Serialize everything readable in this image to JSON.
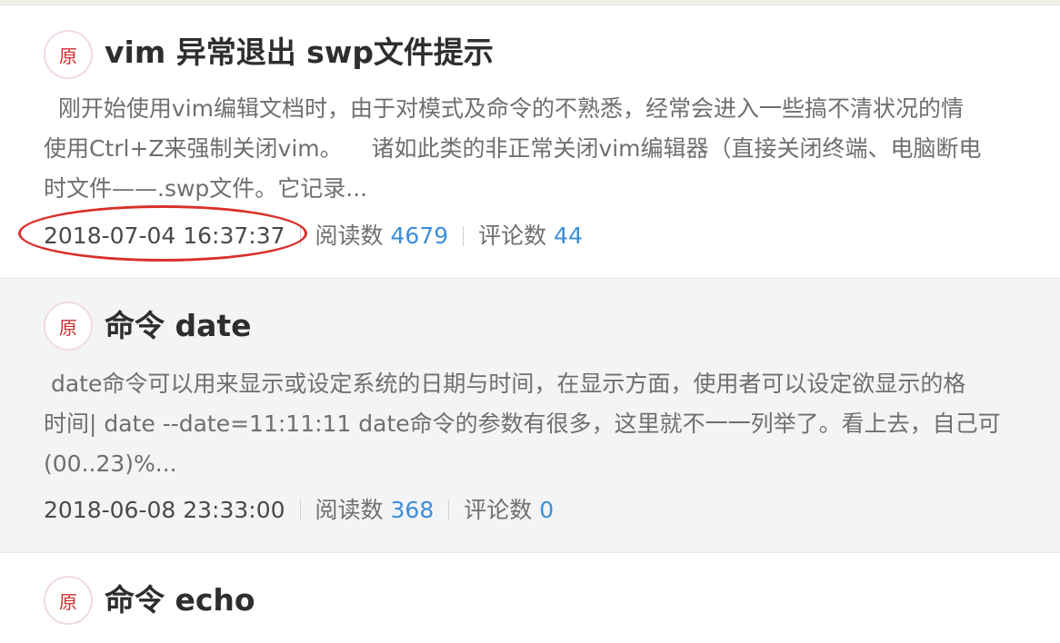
{
  "articles": [
    {
      "badge": "原",
      "title": "vim 异常退出 swp文件提示",
      "summary_lines": [
        "  刚开始使用vim编辑文档时，由于对模式及命令的不熟悉，经常会进入一些搞不清状况的情",
        "使用Ctrl+Z来强制关闭vim。    诸如此类的非正常关闭vim编辑器（直接关闭终端、电脑断电",
        "时文件——.swp文件。它记录..."
      ],
      "date": "2018-07-04 16:37:37",
      "read_label": "阅读数",
      "read_count": "4679",
      "comment_label": "评论数",
      "comment_count": "44"
    },
    {
      "badge": "原",
      "title": "命令 date",
      "summary_lines": [
        " date命令可以用来显示或设定系统的日期与时间，在显示方面，使用者可以设定欲显示的格",
        "时间| date --date=11:11:11 date命令的参数有很多，这里就不一一列举了。看上去，自己可",
        "(00..23)%..."
      ],
      "date": "2018-06-08 23:33:00",
      "read_label": "阅读数",
      "read_count": "368",
      "comment_label": "评论数",
      "comment_count": "0"
    },
    {
      "badge": "原",
      "title": "命令 echo"
    }
  ],
  "annotation": {
    "color": "#d9302a"
  }
}
